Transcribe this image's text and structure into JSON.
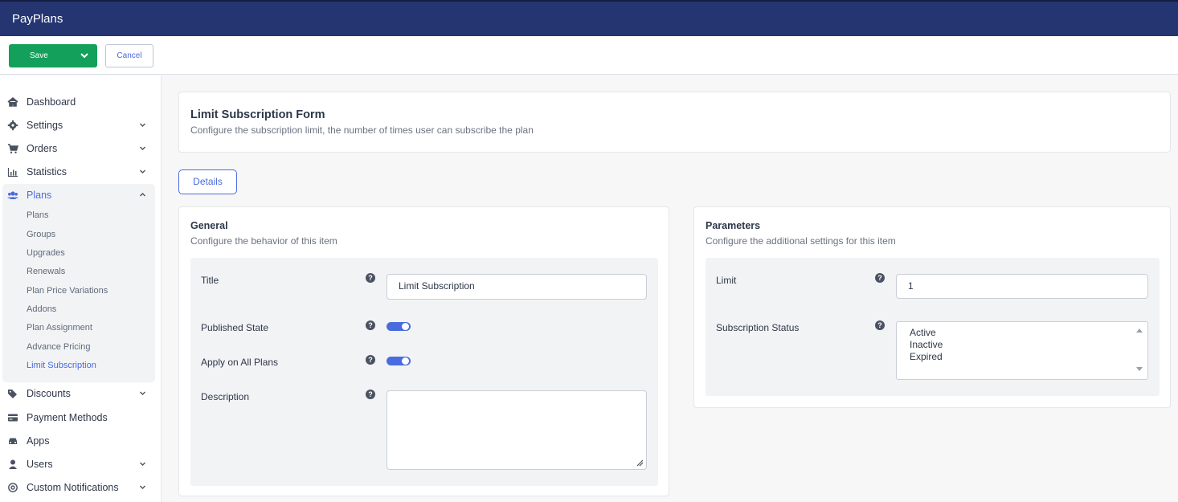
{
  "app": {
    "title": "PayPlans"
  },
  "toolbar": {
    "save_label": "Save",
    "cancel_label": "Cancel"
  },
  "sidebar": {
    "items": [
      {
        "label": "Dashboard",
        "icon": "home-icon"
      },
      {
        "label": "Settings",
        "icon": "gear-icon"
      },
      {
        "label": "Orders",
        "icon": "cart-icon"
      },
      {
        "label": "Statistics",
        "icon": "bar-chart-icon"
      },
      {
        "label": "Plans",
        "icon": "users-icon"
      },
      {
        "label": "Discounts",
        "icon": "tags-icon"
      },
      {
        "label": "Payment Methods",
        "icon": "credit-card-icon"
      },
      {
        "label": "Apps",
        "icon": "car-icon"
      },
      {
        "label": "Users",
        "icon": "user-icon"
      },
      {
        "label": "Custom Notifications",
        "icon": "at-icon"
      }
    ],
    "plans_submenu": [
      "Plans",
      "Groups",
      "Upgrades",
      "Renewals",
      "Plan Price Variations",
      "Addons",
      "Plan Assignment",
      "Advance Pricing",
      "Limit Subscription"
    ]
  },
  "header": {
    "title": "Limit Subscription Form",
    "subtitle": "Configure the subscription limit, the number of times user can subscribe the plan"
  },
  "tabs": {
    "details": "Details"
  },
  "general": {
    "title": "General",
    "subtitle": "Configure the behavior of this item",
    "fields": {
      "title_label": "Title",
      "title_value": "Limit Subscription",
      "published_label": "Published State",
      "published_on": true,
      "apply_all_label": "Apply on All Plans",
      "apply_all_on": true,
      "description_label": "Description",
      "description_value": ""
    }
  },
  "parameters": {
    "title": "Parameters",
    "subtitle": "Configure the additional settings for this item",
    "fields": {
      "limit_label": "Limit",
      "limit_value": "1",
      "status_label": "Subscription Status",
      "status_options": [
        "Active",
        "Inactive",
        "Expired"
      ]
    }
  },
  "colors": {
    "topbar": "#243572",
    "save": "#13a05a",
    "accent": "#4a6bdf"
  }
}
